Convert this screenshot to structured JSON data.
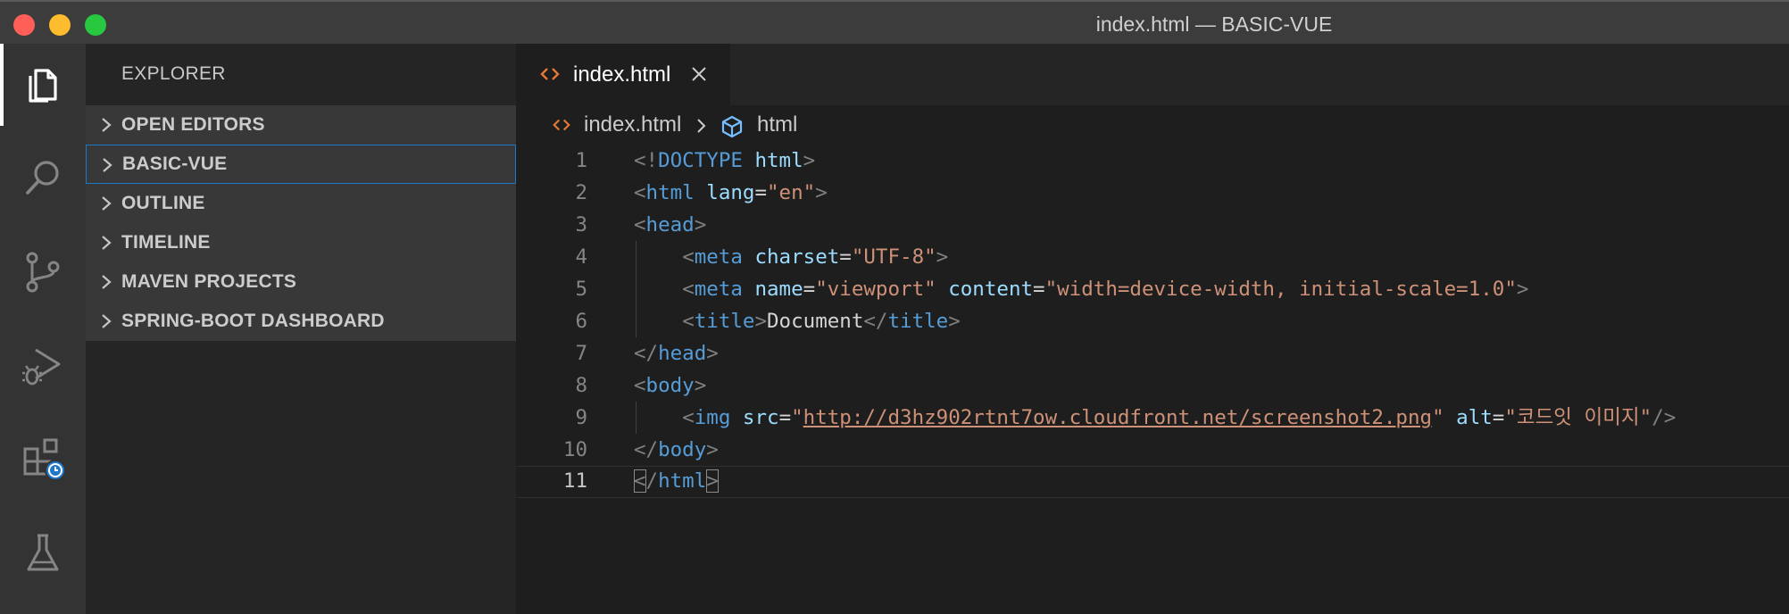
{
  "window": {
    "title": "index.html — BASIC-VUE"
  },
  "activity_bar": {
    "items": [
      {
        "name": "explorer-icon",
        "active": true
      },
      {
        "name": "search-icon",
        "active": false
      },
      {
        "name": "source-control-icon",
        "active": false
      },
      {
        "name": "run-debug-icon",
        "active": false
      },
      {
        "name": "extensions-icon",
        "active": false
      },
      {
        "name": "testing-icon",
        "active": false
      }
    ]
  },
  "sidebar": {
    "header": "EXPLORER",
    "sections": [
      {
        "label": "OPEN EDITORS",
        "expanded": false
      },
      {
        "label": "BASIC-VUE",
        "expanded": false,
        "focused": true
      },
      {
        "label": "OUTLINE",
        "expanded": false
      },
      {
        "label": "TIMELINE",
        "expanded": false
      },
      {
        "label": "MAVEN PROJECTS",
        "expanded": false
      },
      {
        "label": "SPRING-BOOT DASHBOARD",
        "expanded": false
      }
    ]
  },
  "editor": {
    "tab": {
      "filename": "index.html",
      "icon": "html-file-icon"
    },
    "breadcrumbs": {
      "file": "index.html",
      "symbol": "html"
    },
    "lines": [
      {
        "n": "1",
        "indent": 0,
        "tokens": [
          [
            "punc",
            "<!"
          ],
          [
            "tag",
            "DOCTYPE"
          ],
          [
            "text",
            " "
          ],
          [
            "attr",
            "html"
          ],
          [
            "punc",
            ">"
          ]
        ]
      },
      {
        "n": "2",
        "indent": 0,
        "tokens": [
          [
            "punc",
            "<"
          ],
          [
            "tag",
            "html"
          ],
          [
            "text",
            " "
          ],
          [
            "attr",
            "lang"
          ],
          [
            "text",
            "="
          ],
          [
            "str",
            "\"en\""
          ],
          [
            "punc",
            ">"
          ]
        ]
      },
      {
        "n": "3",
        "indent": 0,
        "tokens": [
          [
            "punc",
            "<"
          ],
          [
            "tag",
            "head"
          ],
          [
            "punc",
            ">"
          ]
        ]
      },
      {
        "n": "4",
        "indent": 1,
        "tokens": [
          [
            "punc",
            "<"
          ],
          [
            "tag",
            "meta"
          ],
          [
            "text",
            " "
          ],
          [
            "attr",
            "charset"
          ],
          [
            "text",
            "="
          ],
          [
            "str",
            "\"UTF-8\""
          ],
          [
            "punc",
            ">"
          ]
        ]
      },
      {
        "n": "5",
        "indent": 1,
        "tokens": [
          [
            "punc",
            "<"
          ],
          [
            "tag",
            "meta"
          ],
          [
            "text",
            " "
          ],
          [
            "attr",
            "name"
          ],
          [
            "text",
            "="
          ],
          [
            "str",
            "\"viewport\""
          ],
          [
            "text",
            " "
          ],
          [
            "attr",
            "content"
          ],
          [
            "text",
            "="
          ],
          [
            "str",
            "\"width=device-width, initial-scale=1.0\""
          ],
          [
            "punc",
            ">"
          ]
        ]
      },
      {
        "n": "6",
        "indent": 1,
        "tokens": [
          [
            "punc",
            "<"
          ],
          [
            "tag",
            "title"
          ],
          [
            "punc",
            ">"
          ],
          [
            "text",
            "Document"
          ],
          [
            "punc",
            "</"
          ],
          [
            "tag",
            "title"
          ],
          [
            "punc",
            ">"
          ]
        ]
      },
      {
        "n": "7",
        "indent": 0,
        "tokens": [
          [
            "punc",
            "</"
          ],
          [
            "tag",
            "head"
          ],
          [
            "punc",
            ">"
          ]
        ]
      },
      {
        "n": "8",
        "indent": 0,
        "tokens": [
          [
            "punc",
            "<"
          ],
          [
            "tag",
            "body"
          ],
          [
            "punc",
            ">"
          ]
        ]
      },
      {
        "n": "9",
        "indent": 1,
        "tokens": [
          [
            "punc",
            "<"
          ],
          [
            "tag",
            "img"
          ],
          [
            "text",
            " "
          ],
          [
            "attr",
            "src"
          ],
          [
            "text",
            "="
          ],
          [
            "str",
            "\""
          ],
          [
            "link",
            "http://d3hz902rtnt7ow.cloudfront.net/screenshot2.png"
          ],
          [
            "str",
            "\""
          ],
          [
            "text",
            " "
          ],
          [
            "attr",
            "alt"
          ],
          [
            "text",
            "="
          ],
          [
            "str",
            "\"코드잇 이미지\""
          ],
          [
            "punc",
            "/>"
          ]
        ]
      },
      {
        "n": "10",
        "indent": 0,
        "tokens": [
          [
            "punc",
            "</"
          ],
          [
            "tag",
            "body"
          ],
          [
            "punc",
            ">"
          ]
        ]
      },
      {
        "n": "11",
        "indent": 0,
        "current": true,
        "tokens": [
          [
            "bracket",
            "<"
          ],
          [
            "punc",
            "/"
          ],
          [
            "tag",
            "html"
          ],
          [
            "bracket",
            ">"
          ]
        ]
      }
    ]
  },
  "colors": {
    "tag": "#569cd6",
    "attribute": "#9cdcfe",
    "string": "#ce9178",
    "punctuation": "#808080",
    "focus_border": "#1f78c8",
    "badge": "#1f78c8"
  }
}
